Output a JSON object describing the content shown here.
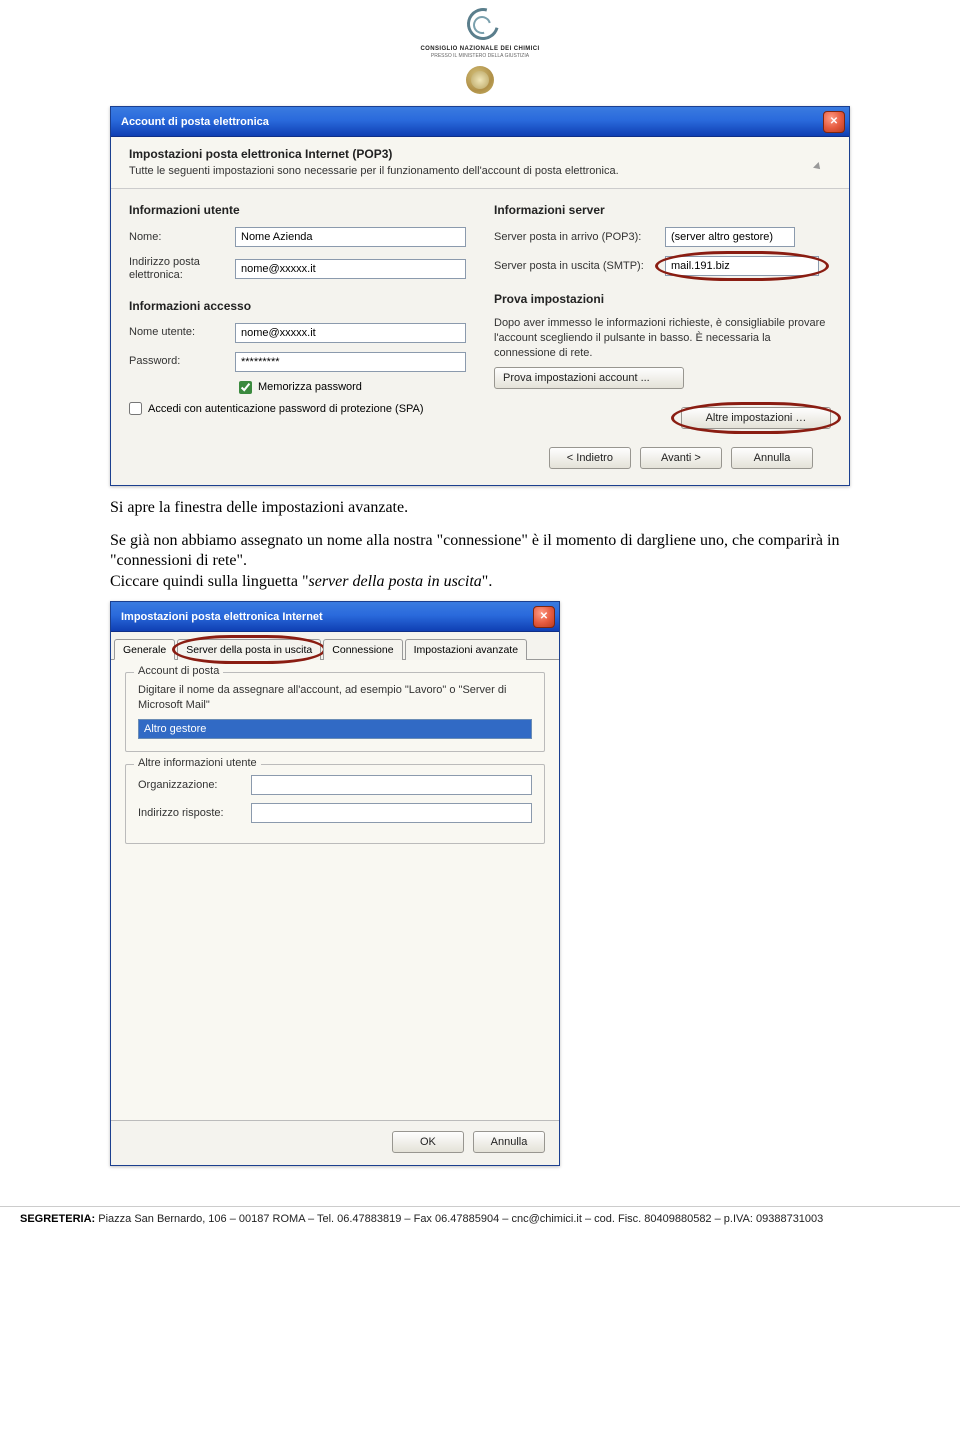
{
  "header": {
    "org_name": "CONSIGLIO NAZIONALE DEI CHIMICI",
    "org_sub": "PRESSO IL MINISTERO DELLA GIUSTIZIA"
  },
  "dialog1": {
    "title": "Account di posta elettronica",
    "header_title": "Impostazioni posta elettronica Internet (POP3)",
    "header_sub": "Tutte le seguenti impostazioni sono necessarie per il funzionamento dell'account di posta elettronica.",
    "sections": {
      "user": {
        "title": "Informazioni utente",
        "name_label": "Nome:",
        "name_value": "Nome Azienda",
        "email_label": "Indirizzo posta elettronica:",
        "email_value": "nome@xxxxx.it"
      },
      "server": {
        "title": "Informazioni server",
        "pop3_label": "Server posta in arrivo (POP3):",
        "pop3_value": "(server altro gestore)",
        "smtp_label": "Server posta in uscita (SMTP):",
        "smtp_value": "mail.191.biz"
      },
      "access": {
        "title": "Informazioni accesso",
        "user_label": "Nome utente:",
        "user_value": "nome@xxxxx.it",
        "pwd_label": "Password:",
        "pwd_value": "*********",
        "remember": "Memorizza password",
        "spa": "Accedi con autenticazione password di protezione (SPA)"
      },
      "test": {
        "title": "Prova impostazioni",
        "desc": "Dopo aver immesso le informazioni richieste, è consigliabile provare l'account scegliendo il pulsante in basso. È necessaria la connessione di rete.",
        "test_btn": "Prova impostazioni account ...",
        "more_btn": "Altre impostazioni …"
      }
    },
    "footer": {
      "back": "< Indietro",
      "next": "Avanti >",
      "cancel": "Annulla"
    }
  },
  "doc": {
    "para1": "Si apre la finestra delle impostazioni avanzate.",
    "para2a": "Se già non abbiamo assegnato un nome alla nostra \"connessione\" è il momento di dargliene uno, che comparirà in \"connessioni di rete\".",
    "para2b": "Ciccare quindi sulla linguetta \"",
    "para2c": "server della posta in uscita",
    "para2d": "\"."
  },
  "dialog2": {
    "title": "Impostazioni posta elettronica Internet",
    "tabs": {
      "general": "Generale",
      "smtp": "Server della posta in uscita",
      "conn": "Connessione",
      "adv": "Impostazioni avanzate"
    },
    "account": {
      "legend": "Account di posta",
      "desc": "Digitare il nome da assegnare all'account, ad esempio \"Lavoro\" o \"Server di Microsoft Mail\"",
      "value": "Altro gestore"
    },
    "other": {
      "legend": "Altre informazioni utente",
      "org_label": "Organizzazione:",
      "org_value": "",
      "reply_label": "Indirizzo risposte:",
      "reply_value": ""
    },
    "footer": {
      "ok": "OK",
      "cancel": "Annulla"
    }
  },
  "page_footer": {
    "label": "SEGRETERIA:",
    "text": " Piazza San Bernardo, 106 – 00187 ROMA – Tel. 06.47883819 – Fax 06.47885904 – cnc@chimici.it – cod. Fisc. 80409880582 – p.IVA: 09388731003"
  }
}
